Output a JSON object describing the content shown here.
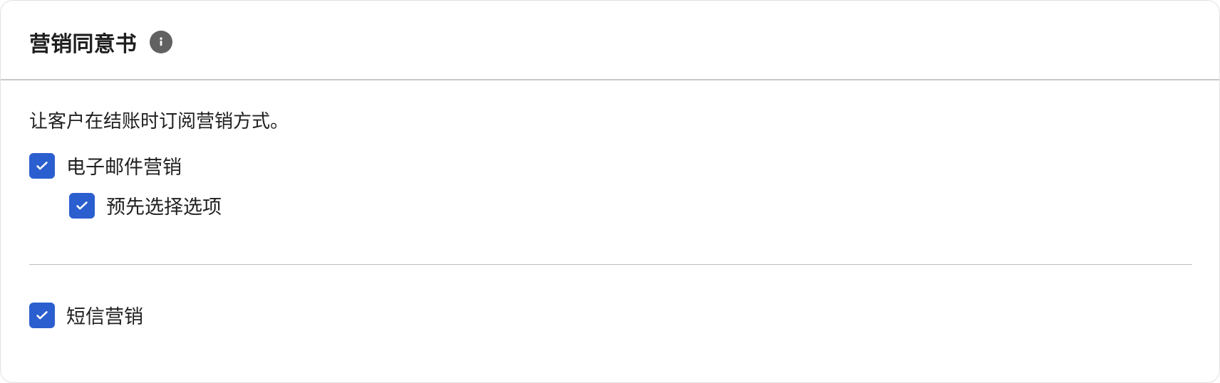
{
  "header": {
    "title": "营销同意书",
    "info_icon": "info-icon"
  },
  "description": "让客户在结账时订阅营销方式。",
  "options": {
    "email_marketing": {
      "label": "电子邮件营销",
      "checked": true
    },
    "preselect_option": {
      "label": "预先选择选项",
      "checked": true
    },
    "sms_marketing": {
      "label": "短信营销",
      "checked": true
    }
  },
  "colors": {
    "accent": "#2b5fcf",
    "text": "#1f1f1f",
    "divider": "#bdbdbd",
    "icon": "#616161"
  }
}
